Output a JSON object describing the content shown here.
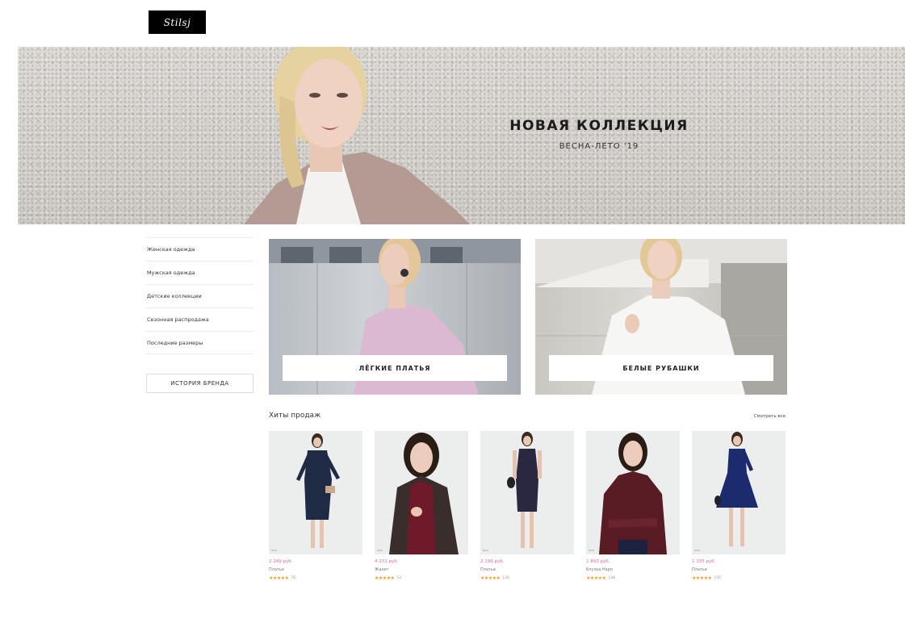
{
  "logo": {
    "text": "Stilsj"
  },
  "hero": {
    "title": "НОВАЯ КОЛЛЕКЦИЯ",
    "subtitle": "ВЕСНА-ЛЕТО '19"
  },
  "sidebar": {
    "items": [
      {
        "label": "Женская одежда"
      },
      {
        "label": "Мужская одежда"
      },
      {
        "label": "Детские коллекции"
      },
      {
        "label": "Сезонная распродажа"
      },
      {
        "label": "Последние размеры"
      }
    ],
    "brand_button": "ИСТОРИЯ БРЕНДА"
  },
  "tiles": [
    {
      "label": "ЛЁГКИЕ ПЛАТЬЯ"
    },
    {
      "label": "БЕЛЫЕ РУБАШКИ"
    }
  ],
  "bestsellers": {
    "title": "Хиты продаж",
    "see_all": "Смотреть все",
    "products": [
      {
        "price": "2 249 руб.",
        "name": "Платье",
        "stars": "★★★★★",
        "reviews": "76",
        "img_tag": "NEW",
        "garment_color": "#1f2a44"
      },
      {
        "price": "4 151 руб.",
        "name": "Жакет",
        "stars": "★★★★★",
        "reviews": "53",
        "img_tag": "NEW",
        "garment_color": "#4a1a22"
      },
      {
        "price": "2 199 руб.",
        "name": "Платье",
        "stars": "★★★★★",
        "reviews": "134",
        "img_tag": "NEW",
        "garment_color": "#2a2840"
      },
      {
        "price": "1 893 руб.",
        "name": "Блузка Наро",
        "stars": "★★★★★",
        "reviews": "138",
        "img_tag": "NEW",
        "garment_color": "#5a1c24"
      },
      {
        "price": "1 155 руб.",
        "name": "Платье",
        "stars": "★★★★★",
        "reviews": "156",
        "img_tag": "NEW",
        "garment_color": "#1c2b6e"
      }
    ]
  },
  "colors": {
    "accent_price": "#e6659f",
    "star": "#f29a2e"
  }
}
